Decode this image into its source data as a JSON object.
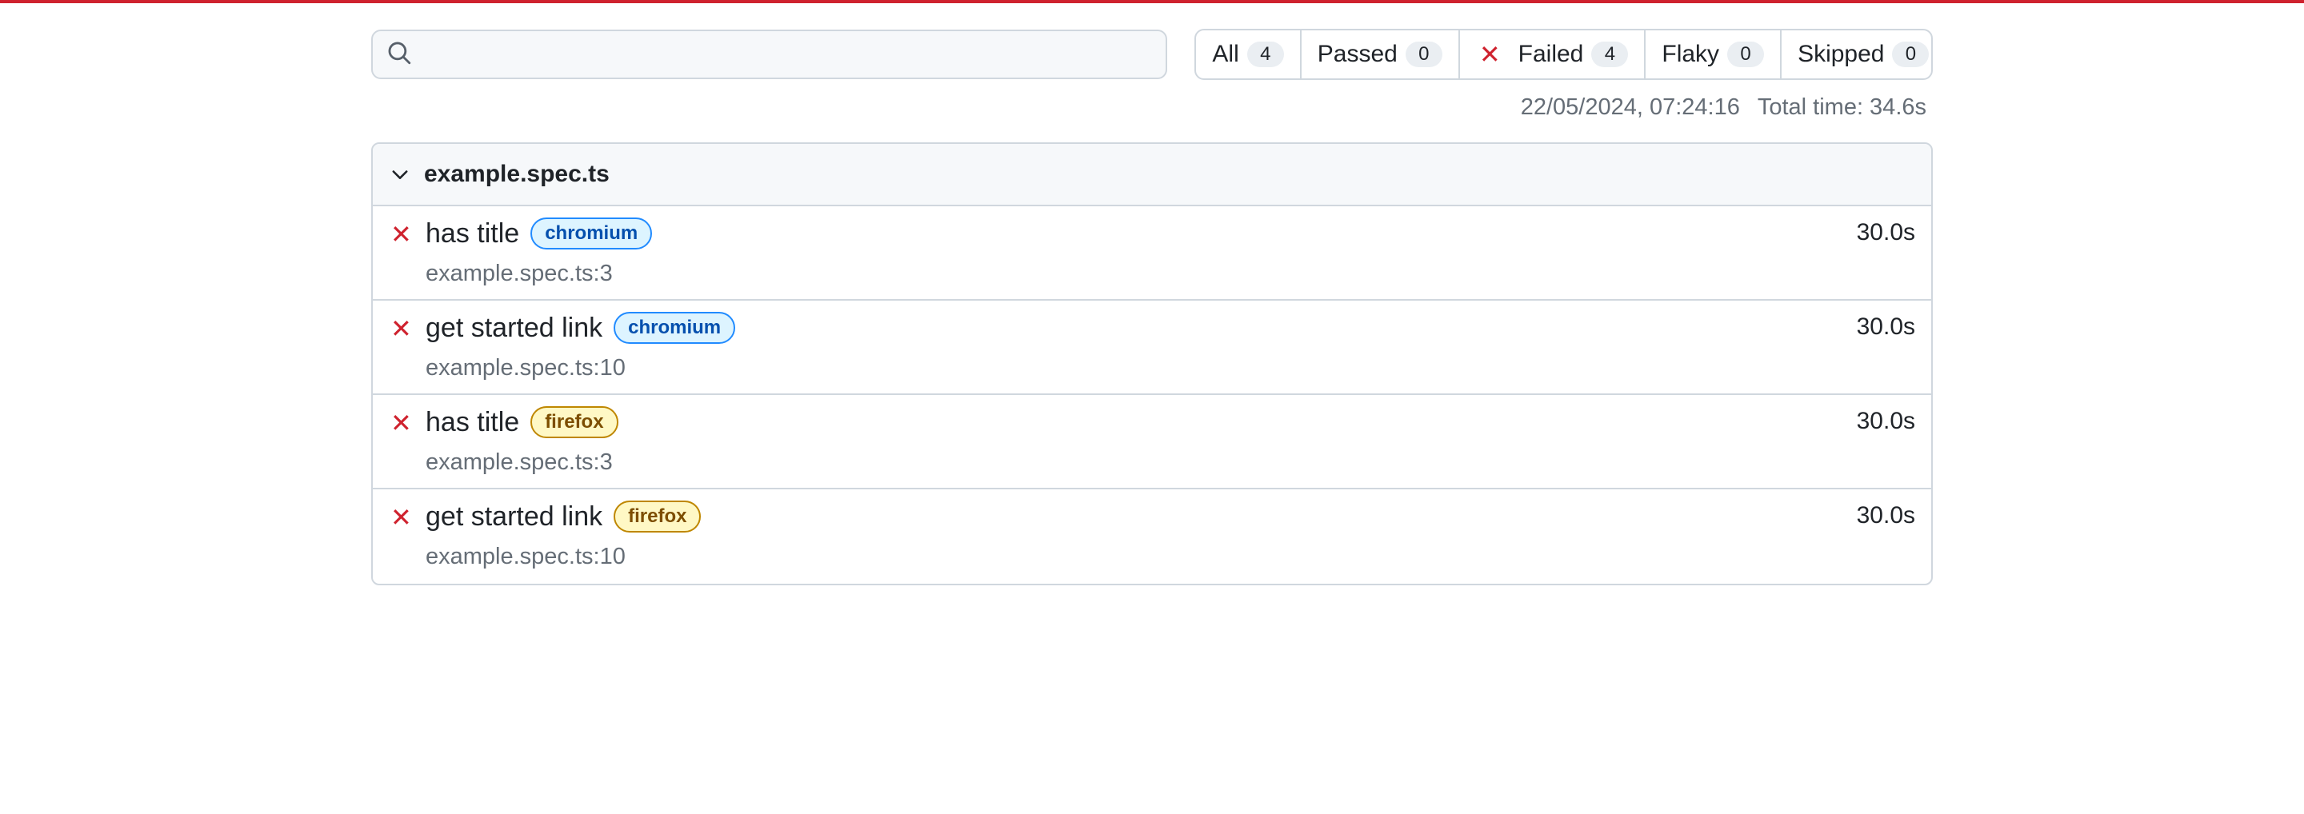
{
  "colors": {
    "accent_bar": "#cf222e",
    "failed": "#cf222e"
  },
  "search": {
    "placeholder": "",
    "value": ""
  },
  "filters": [
    {
      "label": "All",
      "count": "4"
    },
    {
      "label": "Passed",
      "count": "0"
    },
    {
      "label": "Failed",
      "count": "4",
      "icon": "x-icon"
    },
    {
      "label": "Flaky",
      "count": "0"
    },
    {
      "label": "Skipped",
      "count": "0"
    }
  ],
  "meta": {
    "timestamp": "22/05/2024, 07:24:16",
    "total_time": "Total time: 34.6s"
  },
  "file": {
    "name": "example.spec.ts",
    "tests": [
      {
        "title": "has title",
        "project": "chromium",
        "location": "example.spec.ts:3",
        "duration": "30.0s",
        "status": "failed"
      },
      {
        "title": "get started link",
        "project": "chromium",
        "location": "example.spec.ts:10",
        "duration": "30.0s",
        "status": "failed"
      },
      {
        "title": "has title",
        "project": "firefox",
        "location": "example.spec.ts:3",
        "duration": "30.0s",
        "status": "failed"
      },
      {
        "title": "get started link",
        "project": "firefox",
        "location": "example.spec.ts:10",
        "duration": "30.0s",
        "status": "failed"
      }
    ]
  }
}
